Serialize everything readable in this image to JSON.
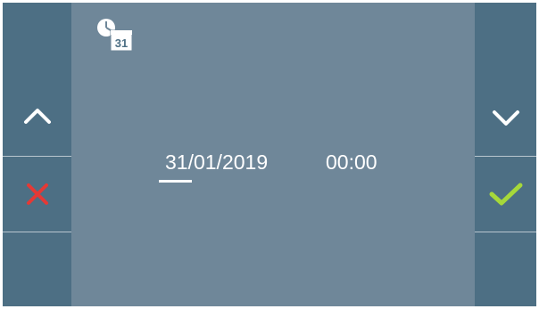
{
  "screen": {
    "title_icon": "clock-calendar-icon",
    "calendar_day": "31",
    "date_value": "31/01/2019",
    "time_value": "00:00",
    "cursor_on": "date-day"
  },
  "left_panel": {
    "up_button": {
      "icon": "chevron-up-icon",
      "color": "#ffffff"
    },
    "cancel_button": {
      "icon": "close-icon",
      "color": "#e53935"
    },
    "empty_button": {}
  },
  "right_panel": {
    "down_button": {
      "icon": "chevron-down-icon",
      "color": "#ffffff"
    },
    "confirm_button": {
      "icon": "check-icon",
      "color": "#a6d83a"
    },
    "empty_button": {}
  },
  "colors": {
    "screen_bg": "#6f8799",
    "panel_bg": "#4d6f84",
    "divider": "#b9c6cf",
    "text": "#ffffff"
  }
}
